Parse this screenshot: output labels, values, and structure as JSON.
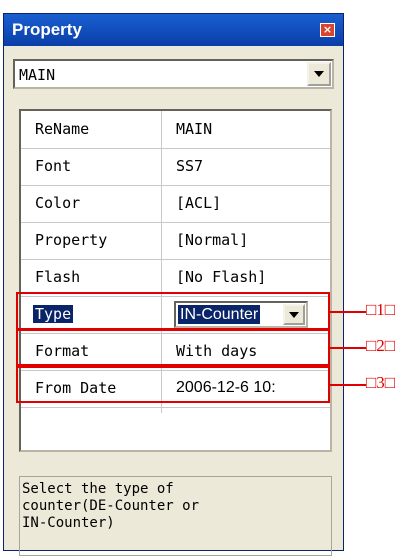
{
  "window": {
    "title": "Property"
  },
  "object_selector": {
    "value": "MAIN"
  },
  "properties": [
    {
      "key": "ReName",
      "value": "MAIN"
    },
    {
      "key": "Font",
      "value": "SS7"
    },
    {
      "key": "Color",
      "value": "[ACL]"
    },
    {
      "key": "Property",
      "value": "[Normal]"
    },
    {
      "key": "Flash",
      "value": "[No Flash]"
    },
    {
      "key": "Type",
      "value": "IN-Counter"
    },
    {
      "key": "Format",
      "value": "With days"
    },
    {
      "key": "From Date",
      "value": "2006-12-6 10:"
    }
  ],
  "callouts": [
    "□1□",
    "□2□",
    "□3□"
  ],
  "description": "Select the type of\ncounter(DE-Counter or\nIN-Counter)",
  "colors": {
    "titlebar": "#0a3ea8",
    "selection": "#0a246a",
    "highlight": "#e00000",
    "panel": "#ece9d8"
  }
}
